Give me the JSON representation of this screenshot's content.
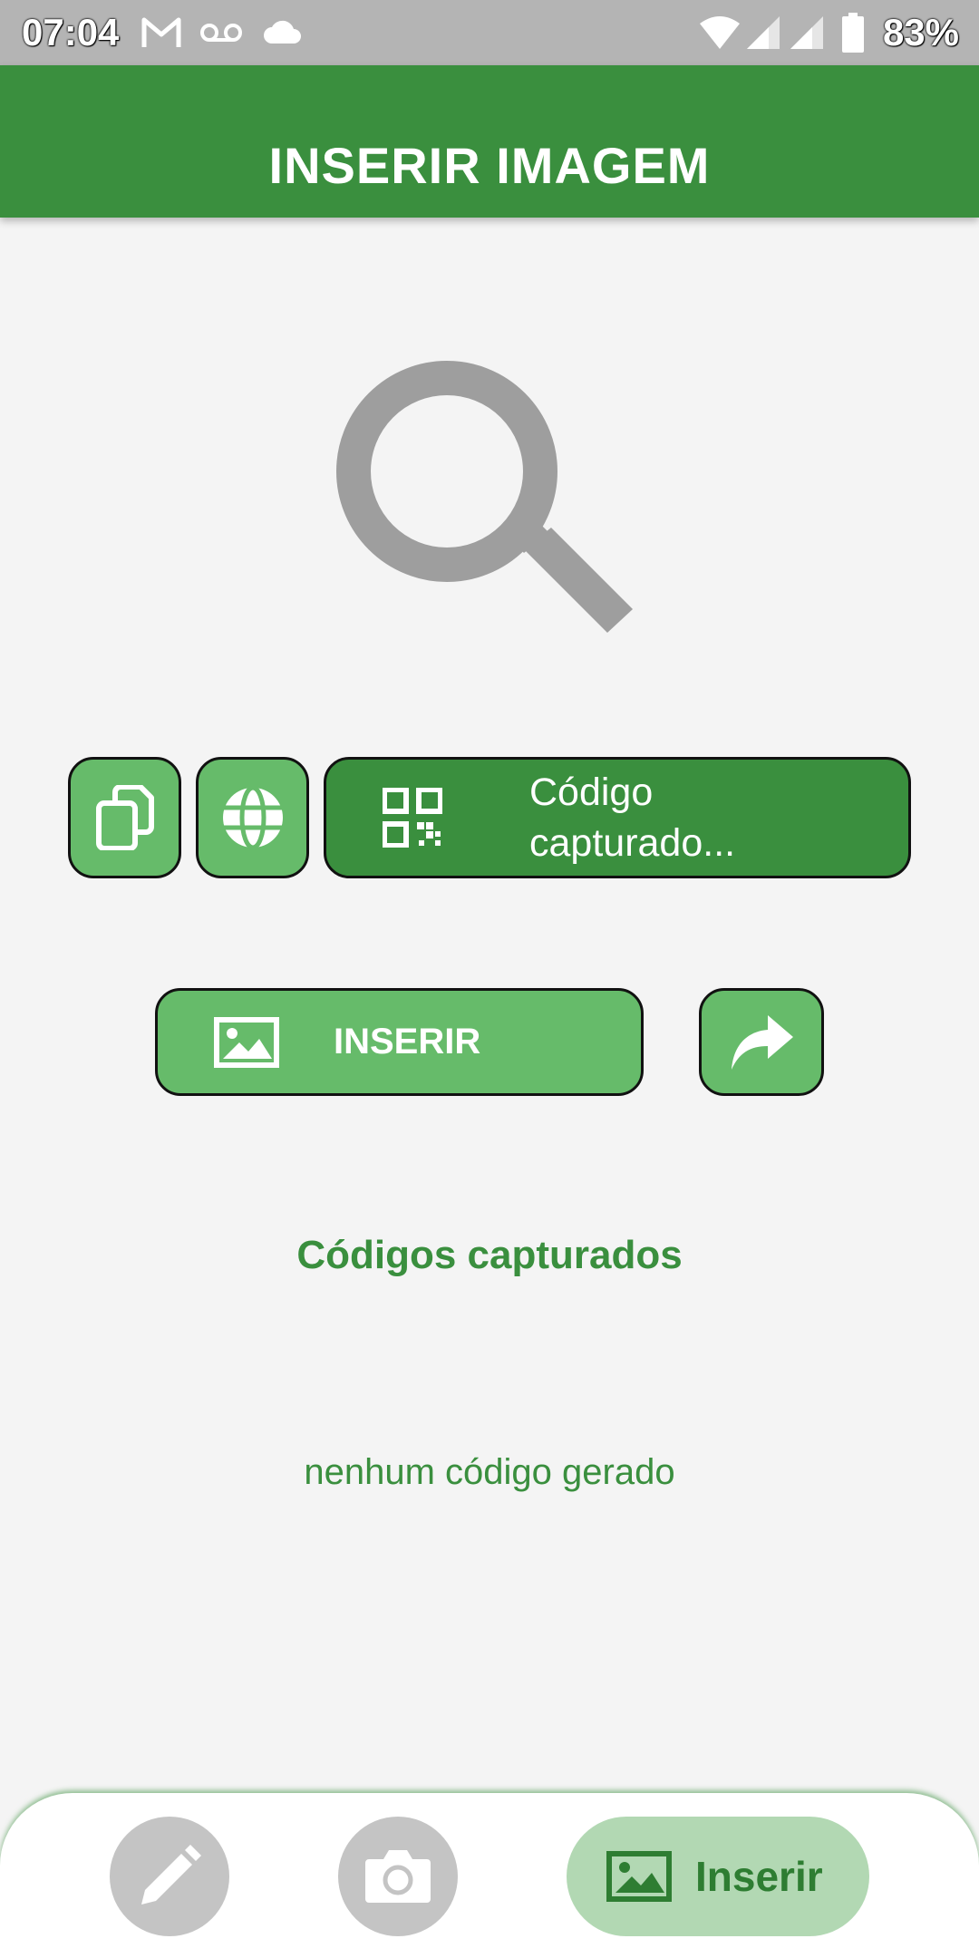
{
  "status_bar": {
    "time": "07:04",
    "battery": "83%",
    "icons": [
      "gmail-icon",
      "voicemail-icon",
      "cloud-icon",
      "wifi-icon",
      "signal-icon",
      "signal-icon",
      "battery-icon"
    ]
  },
  "app_bar": {
    "title": "INSERIR IMAGEM"
  },
  "main": {
    "hero_icon": "search-icon",
    "action_row": {
      "copy_icon": "copy-icon",
      "web_icon": "globe-icon",
      "code_button": {
        "icon": "qr-code-icon",
        "label_line1": "Código",
        "label_line2": "capturado..."
      }
    },
    "insert_button": {
      "icon": "image-icon",
      "label": "INSERIR"
    },
    "share_icon": "share-arrow-icon",
    "captured_section": {
      "title": "Códigos capturados",
      "empty_message": "nenhum código gerado"
    }
  },
  "bottom_nav": {
    "items": [
      {
        "icon": "pencil-icon",
        "label": ""
      },
      {
        "icon": "camera-icon",
        "label": ""
      },
      {
        "icon": "image-icon",
        "label": "Inserir",
        "active": true
      }
    ]
  },
  "colors": {
    "primary": "#3a8f3e",
    "button_light": "#66bb6a",
    "nav_active_bg": "#b2d8b3",
    "background": "#f4f4f4"
  }
}
